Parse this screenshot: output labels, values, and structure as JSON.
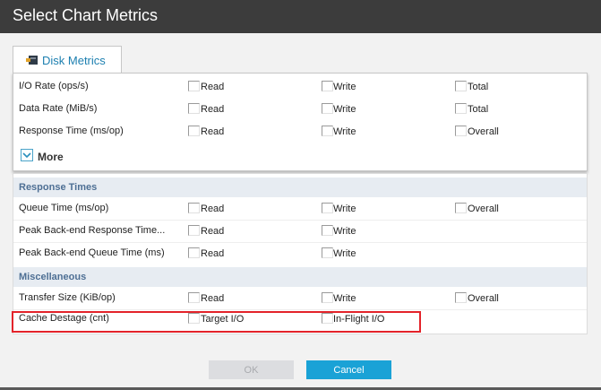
{
  "window": {
    "title": "Select Chart Metrics"
  },
  "tab": {
    "label": "Disk Metrics",
    "icon": "disk-icon"
  },
  "more": {
    "label": "More"
  },
  "rows_top": [
    {
      "label": "I/O Rate (ops/s)",
      "options": [
        "Read",
        "Write",
        "Total"
      ]
    },
    {
      "label": "Data Rate (MiB/s)",
      "options": [
        "Read",
        "Write",
        "Total"
      ]
    },
    {
      "label": "Response Time (ms/op)",
      "options": [
        "Read",
        "Write",
        "Overall"
      ]
    }
  ],
  "sections": [
    {
      "title": "Response Times",
      "rows": [
        {
          "label": "Queue Time (ms/op)",
          "options": [
            "Read",
            "Write",
            "Overall"
          ]
        },
        {
          "label": "Peak Back-end Response Time...",
          "options": [
            "Read",
            "Write"
          ]
        },
        {
          "label": "Peak Back-end Queue Time (ms)",
          "options": [
            "Read",
            "Write"
          ]
        }
      ]
    },
    {
      "title": "Miscellaneous",
      "rows": [
        {
          "label": "Transfer Size (KiB/op)",
          "options": [
            "Read",
            "Write",
            "Overall"
          ]
        },
        {
          "label": "Cache Destage (cnt)",
          "options": [
            "Target I/O",
            "In-Flight I/O"
          ]
        }
      ]
    }
  ],
  "buttons": {
    "ok": "OK",
    "cancel": "Cancel"
  },
  "colors": {
    "accent": "#1aa2d6",
    "highlight": "#e3232a",
    "titlebar": "#3c3c3c"
  }
}
